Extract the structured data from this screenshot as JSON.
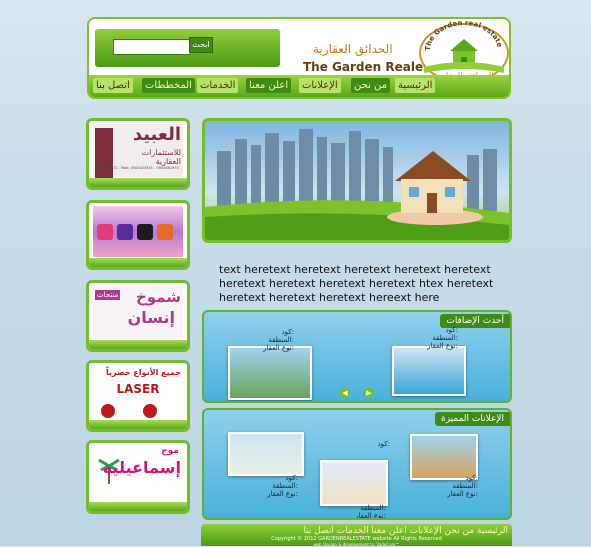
{
  "header": {
    "search_button": "ابحث",
    "search_placeholder": "",
    "brand_ar": "الحدائق العقارية",
    "brand_en": "The Garden Realestate",
    "logo_text_en": "The Garden real estate",
    "logo_text_ar": "الحدائق العقارية"
  },
  "nav": {
    "items": [
      "الرئيسية",
      "من نحن",
      "الإعلانات",
      "اعلن معنا",
      "الخدمات",
      "المخططات",
      "اتصل بنا"
    ]
  },
  "ads": [
    {
      "title": "العبيد",
      "subtitle": "للاستثمارات العقارية",
      "phone": "Tel: 2641072 - Mob: 0505423551 - 0504881970"
    },
    {
      "title": "",
      "subtitle": ""
    },
    {
      "title": "شموخ",
      "subtitle": "إنسان",
      "label": "منتجات"
    },
    {
      "title": "جميع الأنواع حصرياً",
      "subtitle": "LASER"
    },
    {
      "title": "موج",
      "subtitle": "إسماعيلية"
    }
  ],
  "intro": {
    "text": "text heretext heretext heretext heretext heretext heretext heretext heretext heretext htex heretext heretext heretext heretext hereext here"
  },
  "latest": {
    "title": "أحدث الإضافات",
    "items": [
      {
        "code": "كود:",
        "area": "المنطقة:",
        "type": "نوع العقار:"
      },
      {
        "code": "كود:",
        "area": "المنطقة:",
        "type": "نوع العقار:"
      }
    ]
  },
  "featured": {
    "title": "الإعلانات المميزة",
    "items": [
      {
        "code": "كود:",
        "area": "المنطقة:",
        "type": "نوع العقار:"
      },
      {
        "code": "كود:",
        "area": "المنطقة:",
        "type": "نوع العقار:"
      },
      {
        "code": "كود:",
        "area": "المنطقة:",
        "type": "نوع العقار:"
      }
    ]
  },
  "footer": {
    "links": "الرئيسية  من نحن  الإعلانات  اعلن معنا  الخدمات  اتصل بنا",
    "copyright": "Copyright © 2012 GARDENREALESTATE website All Rights Reserved",
    "credit": "web Design & development by VadeCom™"
  },
  "colors": {
    "green": "#74bd2b",
    "dark_green": "#3f8c14",
    "brown": "#6a3e14",
    "sky": "#4ab0da"
  }
}
